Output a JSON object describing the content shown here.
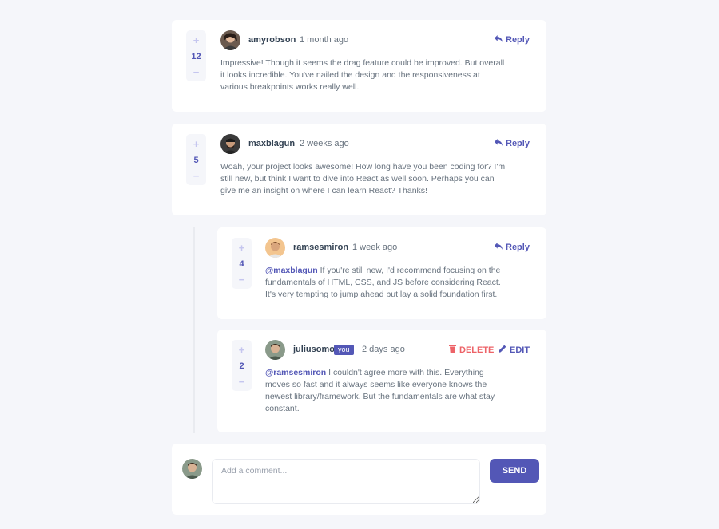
{
  "comments": [
    {
      "username": "amyrobson",
      "time": "1 month ago",
      "score": "12",
      "reply_label": "Reply",
      "content": "Impressive! Though it seems the drag feature could be improved. But overall it looks incredible. You've nailed the design and the responsiveness at various breakpoints works really well."
    },
    {
      "username": "maxblagun",
      "time": "2 weeks ago",
      "score": "5",
      "reply_label": "Reply",
      "content": "Woah, your project looks awesome! How long have you been coding for? I'm still new, but think I want to dive into React as well soon. Perhaps you can give me an insight on where I can learn React? Thanks!"
    }
  ],
  "replies": [
    {
      "username": "ramsesmiron",
      "time": "1 week ago",
      "score": "4",
      "reply_label": "Reply",
      "mention": "@maxblagun",
      "content": " If you're still new, I'd recommend focusing on the fundamentals of HTML, CSS, and JS before considering React. It's very tempting to jump ahead but lay a solid foundation first."
    },
    {
      "username": "juliusomo",
      "you_badge": "you",
      "time": "2 days ago",
      "score": "2",
      "delete_label": "DELETE",
      "edit_label": "EDIT",
      "mention": "@ramsesmiron",
      "content": " I couldn't agree more with this. Everything moves so fast and it always seems like everyone knows the newest library/framework. But the fundamentals are what stay constant."
    }
  ],
  "vote": {
    "plus": "+",
    "minus": "−"
  },
  "composer": {
    "placeholder": "Add a comment...",
    "send_label": "SEND"
  },
  "icons": {
    "reply": "reply-icon",
    "delete": "trash-icon",
    "edit": "pencil-icon"
  },
  "colors": {
    "accent": "#5357b6",
    "danger": "#ed6368",
    "background": "#f5f6fa",
    "card": "#ffffff"
  }
}
